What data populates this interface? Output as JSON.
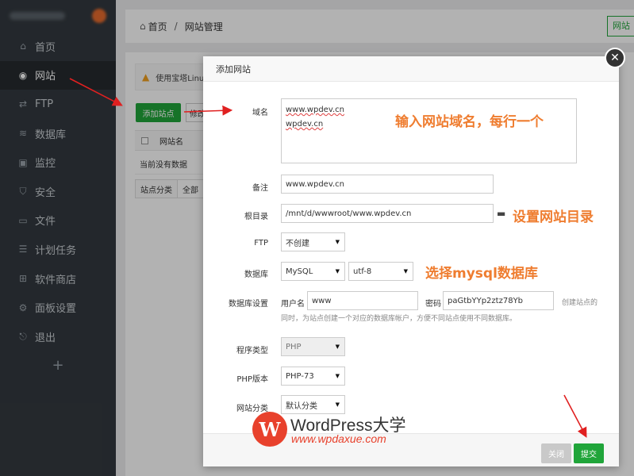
{
  "sidebar": {
    "items": [
      {
        "label": "首页",
        "icon": "home-icon",
        "glyph": "⌂"
      },
      {
        "label": "网站",
        "icon": "globe-icon",
        "glyph": "◉",
        "active": true
      },
      {
        "label": "FTP",
        "icon": "ftp-icon",
        "glyph": "⇄"
      },
      {
        "label": "数据库",
        "icon": "database-icon",
        "glyph": "≋"
      },
      {
        "label": "监控",
        "icon": "monitor-icon",
        "glyph": "▣"
      },
      {
        "label": "安全",
        "icon": "shield-icon",
        "glyph": "⛉"
      },
      {
        "label": "文件",
        "icon": "folder-icon",
        "glyph": "▭"
      },
      {
        "label": "计划任务",
        "icon": "task-icon",
        "glyph": "☰"
      },
      {
        "label": "软件商店",
        "icon": "store-icon",
        "glyph": "⊞"
      },
      {
        "label": "面板设置",
        "icon": "gear-icon",
        "glyph": "⚙"
      },
      {
        "label": "退出",
        "icon": "logout-icon",
        "glyph": "⎋"
      }
    ],
    "add_label": "+"
  },
  "breadcrumb": {
    "home": "首页",
    "sep": "/",
    "current": "网站管理",
    "right_button": "网站"
  },
  "panel": {
    "alert": "使用宝塔Linu",
    "add_site_button": "添加站点",
    "second_button": "修改",
    "col_site_name": "网站名",
    "empty": "当前没有数据",
    "category_label": "站点分类",
    "category_value": "全部"
  },
  "modal": {
    "title": "添加网站",
    "close_glyph": "✕",
    "domain_label": "域名",
    "domain_lines": [
      "www.wpdev.cn",
      "wpdev.cn"
    ],
    "note_label": "备注",
    "note_value": "www.wpdev.cn",
    "root_label": "根目录",
    "root_value": "/mnt/d/wwwroot/www.wpdev.cn",
    "ftp_label": "FTP",
    "ftp_value": "不创建",
    "db_label": "数据库",
    "db_type": "MySQL",
    "db_charset": "utf-8",
    "db_settings_label": "数据库设置",
    "db_user_label": "用户名",
    "db_user_value": "www",
    "db_pass_label": "密码",
    "db_pass_value": "paGtbYYp2ztz78Yb",
    "db_hint_1": "创建站点的",
    "db_hint_2": "同时，为站点创建一个对应的数据库帐户，方便不同站点使用不同数据库。",
    "prog_label": "程序类型",
    "prog_value": "PHP",
    "php_label": "PHP版本",
    "php_value": "PHP-73",
    "cat_label": "网站分类",
    "cat_value": "默认分类",
    "btn_close": "关闭",
    "btn_submit": "提交"
  },
  "annotations": {
    "domain_tip": "输入网站域名，每行一个",
    "root_tip": "设置网站目录",
    "db_tip": "选择mysql数据库"
  },
  "watermark": {
    "title": "WordPress大学",
    "url": "www.wpdaxue.com",
    "logo_letter": "W"
  },
  "colors": {
    "accent": "#20a53a",
    "annotation": "#ef7d30",
    "sidebar": "#33393f",
    "arrow": "#e02020"
  }
}
